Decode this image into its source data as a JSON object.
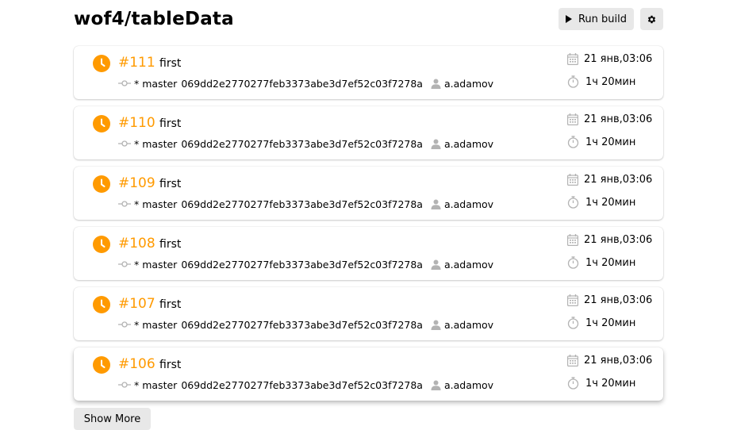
{
  "header": {
    "title": "wof4/tableData",
    "run_build_label": "Run build",
    "settings_icon": "gear-icon"
  },
  "colors": {
    "accent": "#ff9a00",
    "button_bg": "#e8e8e8",
    "icon_gray": "#b3b3b3"
  },
  "builds": [
    {
      "number": "#111",
      "message": "first",
      "branch": "* master",
      "commit": "069dd2e2770277feb3373abe3d7ef52c03f7278a",
      "author": "a.adamov",
      "date": "21 янв,03:06",
      "duration": "1ч 20мин",
      "status": "pending"
    },
    {
      "number": "#110",
      "message": "first",
      "branch": "* master",
      "commit": "069dd2e2770277feb3373abe3d7ef52c03f7278a",
      "author": "a.adamov",
      "date": "21 янв,03:06",
      "duration": "1ч 20мин",
      "status": "pending"
    },
    {
      "number": "#109",
      "message": "first",
      "branch": "* master",
      "commit": "069dd2e2770277feb3373abe3d7ef52c03f7278a",
      "author": "a.adamov",
      "date": "21 янв,03:06",
      "duration": "1ч 20мин",
      "status": "pending"
    },
    {
      "number": "#108",
      "message": "first",
      "branch": "* master",
      "commit": "069dd2e2770277feb3373abe3d7ef52c03f7278a",
      "author": "a.adamov",
      "date": "21 янв,03:06",
      "duration": "1ч 20мин",
      "status": "pending"
    },
    {
      "number": "#107",
      "message": "first",
      "branch": "* master",
      "commit": "069dd2e2770277feb3373abe3d7ef52c03f7278a",
      "author": "a.adamov",
      "date": "21 янв,03:06",
      "duration": "1ч 20мин",
      "status": "pending"
    },
    {
      "number": "#106",
      "message": "first",
      "branch": "* master",
      "commit": "069dd2e2770277feb3373abe3d7ef52c03f7278a",
      "author": "a.adamov",
      "date": "21 янв,03:06",
      "duration": "1ч 20мин",
      "status": "pending"
    }
  ],
  "footer": {
    "show_more_label": "Show More"
  }
}
